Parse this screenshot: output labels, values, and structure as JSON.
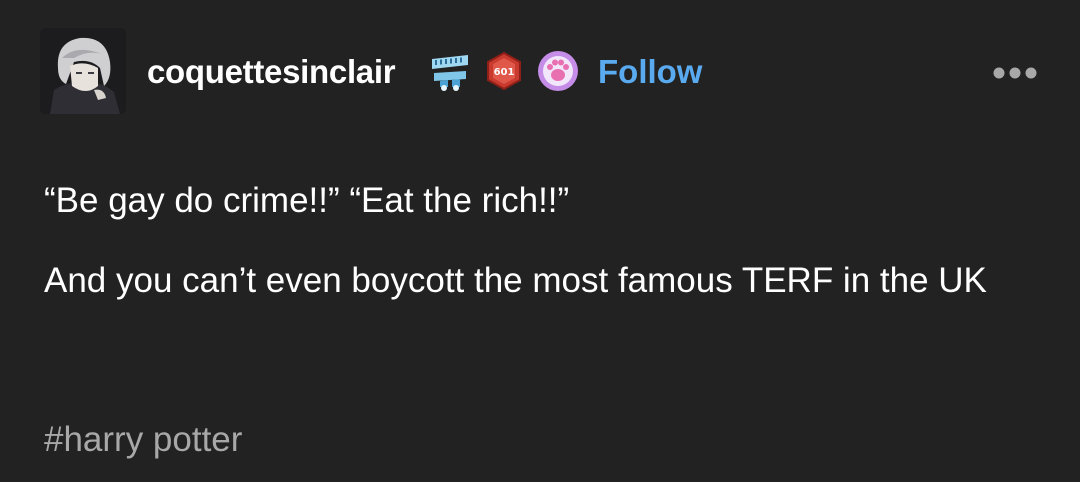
{
  "post": {
    "author": {
      "username": "coquettesinclair",
      "avatar_icon": "avatar-image",
      "follow_label": "Follow",
      "badges": [
        {
          "icon": "teeth-badge-icon"
        },
        {
          "icon": "hexagon-badge-icon",
          "text": "601"
        },
        {
          "icon": "paw-badge-icon"
        }
      ]
    },
    "more_icon": "more-options-icon",
    "paragraphs": [
      "“Be gay do crime!!” “Eat the rich!!”",
      "And you can’t even boycott the most famous TERF in the UK"
    ],
    "tags": [
      "#harry potter"
    ]
  },
  "colors": {
    "background": "#222222",
    "text": "#ffffff",
    "follow": "#5aaaf0",
    "tag": "#a8a8a8"
  }
}
